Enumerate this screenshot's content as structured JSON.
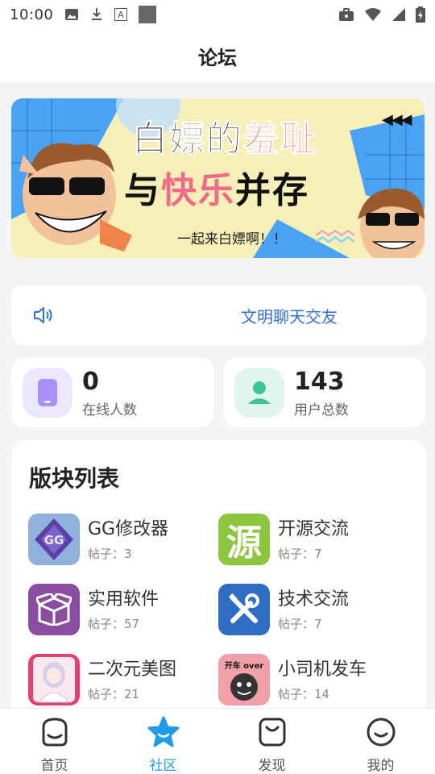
{
  "status_bar": {
    "time": "10:00",
    "icons_left": [
      "image-icon",
      "download-icon",
      "font-icon",
      "square-icon"
    ],
    "icons_right": [
      "briefcase-icon",
      "wifi-icon",
      "signal-icon",
      "battery-icon"
    ]
  },
  "header": {
    "title": "论坛"
  },
  "banner": {
    "line1_a": "白嫖的",
    "line1_b": "羞耻",
    "line2_a": "与",
    "line2_b": "快乐",
    "line2_c": "并存",
    "subtitle": "一起来白嫖啊！！",
    "arrows": "◀◀◀"
  },
  "notice": {
    "text": "文明聊天交友"
  },
  "stats": [
    {
      "value": "0",
      "label": "在线人数"
    },
    {
      "value": "143",
      "label": "用户总数"
    }
  ],
  "boards": {
    "title": "版块列表",
    "items": [
      {
        "name": "GG修改器",
        "count": "帖子：3",
        "icon": "gg-icon"
      },
      {
        "name": "开源交流",
        "count": "帖子：7",
        "icon": "source-icon",
        "glyph": "源"
      },
      {
        "name": "实用软件",
        "count": "帖子：57",
        "icon": "box-icon"
      },
      {
        "name": "技术交流",
        "count": "帖子：7",
        "icon": "tools-icon"
      },
      {
        "name": "二次元美图",
        "count": "帖子：21",
        "icon": "anime-icon"
      },
      {
        "name": "小司机发车",
        "count": "帖子：14",
        "icon": "meme-icon",
        "meme_text": "开车 over"
      }
    ]
  },
  "tabbar": {
    "items": [
      {
        "label": "首页",
        "icon": "home-icon"
      },
      {
        "label": "社区",
        "icon": "star-icon",
        "active": true
      },
      {
        "label": "发现",
        "icon": "discover-icon"
      },
      {
        "label": "我的",
        "icon": "profile-icon"
      }
    ]
  },
  "colors": {
    "accent": "#1f9ce8",
    "notice_text": "#2f6fd6",
    "highlight_pink": "#f06a8a"
  }
}
